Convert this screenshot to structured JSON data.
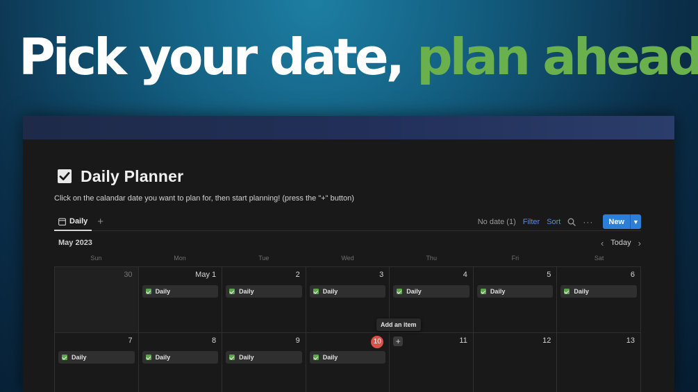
{
  "headline": {
    "part1": "Pick your date,",
    "part2": "plan ahead."
  },
  "page": {
    "title": "Daily Planner",
    "description": "Click on the calandar date you want to plan for, then start planning! (press the \"+\" button)"
  },
  "views": {
    "active_tab": "Daily",
    "add_view": "+"
  },
  "toolbar": {
    "no_date": "No date (1)",
    "filter": "Filter",
    "sort": "Sort",
    "more": "···",
    "new": "New"
  },
  "calendar": {
    "month": "May 2023",
    "today_button": "Today",
    "prev": "‹",
    "next": "›",
    "weekdays": [
      "Sun",
      "Mon",
      "Tue",
      "Wed",
      "Thu",
      "Fri",
      "Sat"
    ],
    "days": [
      {
        "label": "30",
        "dim": true,
        "items": []
      },
      {
        "label": "May 1",
        "items": [
          "Daily"
        ]
      },
      {
        "label": "2",
        "items": [
          "Daily"
        ]
      },
      {
        "label": "3",
        "items": [
          "Daily"
        ]
      },
      {
        "label": "4",
        "items": [
          "Daily"
        ]
      },
      {
        "label": "5",
        "items": [
          "Daily"
        ]
      },
      {
        "label": "6",
        "items": [
          "Daily"
        ]
      },
      {
        "label": "7",
        "items": [
          "Daily"
        ]
      },
      {
        "label": "8",
        "items": [
          "Daily"
        ]
      },
      {
        "label": "9",
        "items": [
          "Daily"
        ]
      },
      {
        "label": "10",
        "today": true,
        "items": [
          "Daily"
        ]
      },
      {
        "label": "11",
        "items": [],
        "add_button": "+"
      },
      {
        "label": "12",
        "items": []
      },
      {
        "label": "13",
        "items": []
      }
    ],
    "tooltip": "Add an item"
  },
  "colors": {
    "accent_green": "#6ab04c",
    "new_button": "#2d7ed8",
    "today_badge": "#d9534a",
    "link_blue": "#5a8ee0"
  }
}
